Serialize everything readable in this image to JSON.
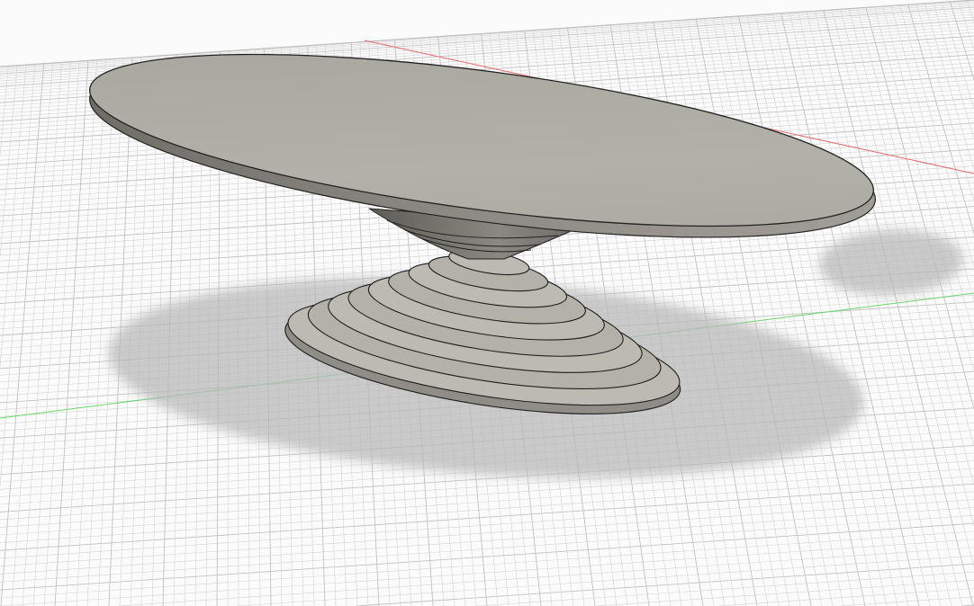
{
  "viewport": {
    "background_color": "#fbfbfb",
    "grid_color": "#d4d4d4",
    "grid_major_color": "#c2c2c2",
    "x_axis_color": "#e05a5a",
    "y_axis_color": "#5ad35a",
    "model_color": "#aaa89e",
    "shadow_color": "#b5b5b5"
  }
}
